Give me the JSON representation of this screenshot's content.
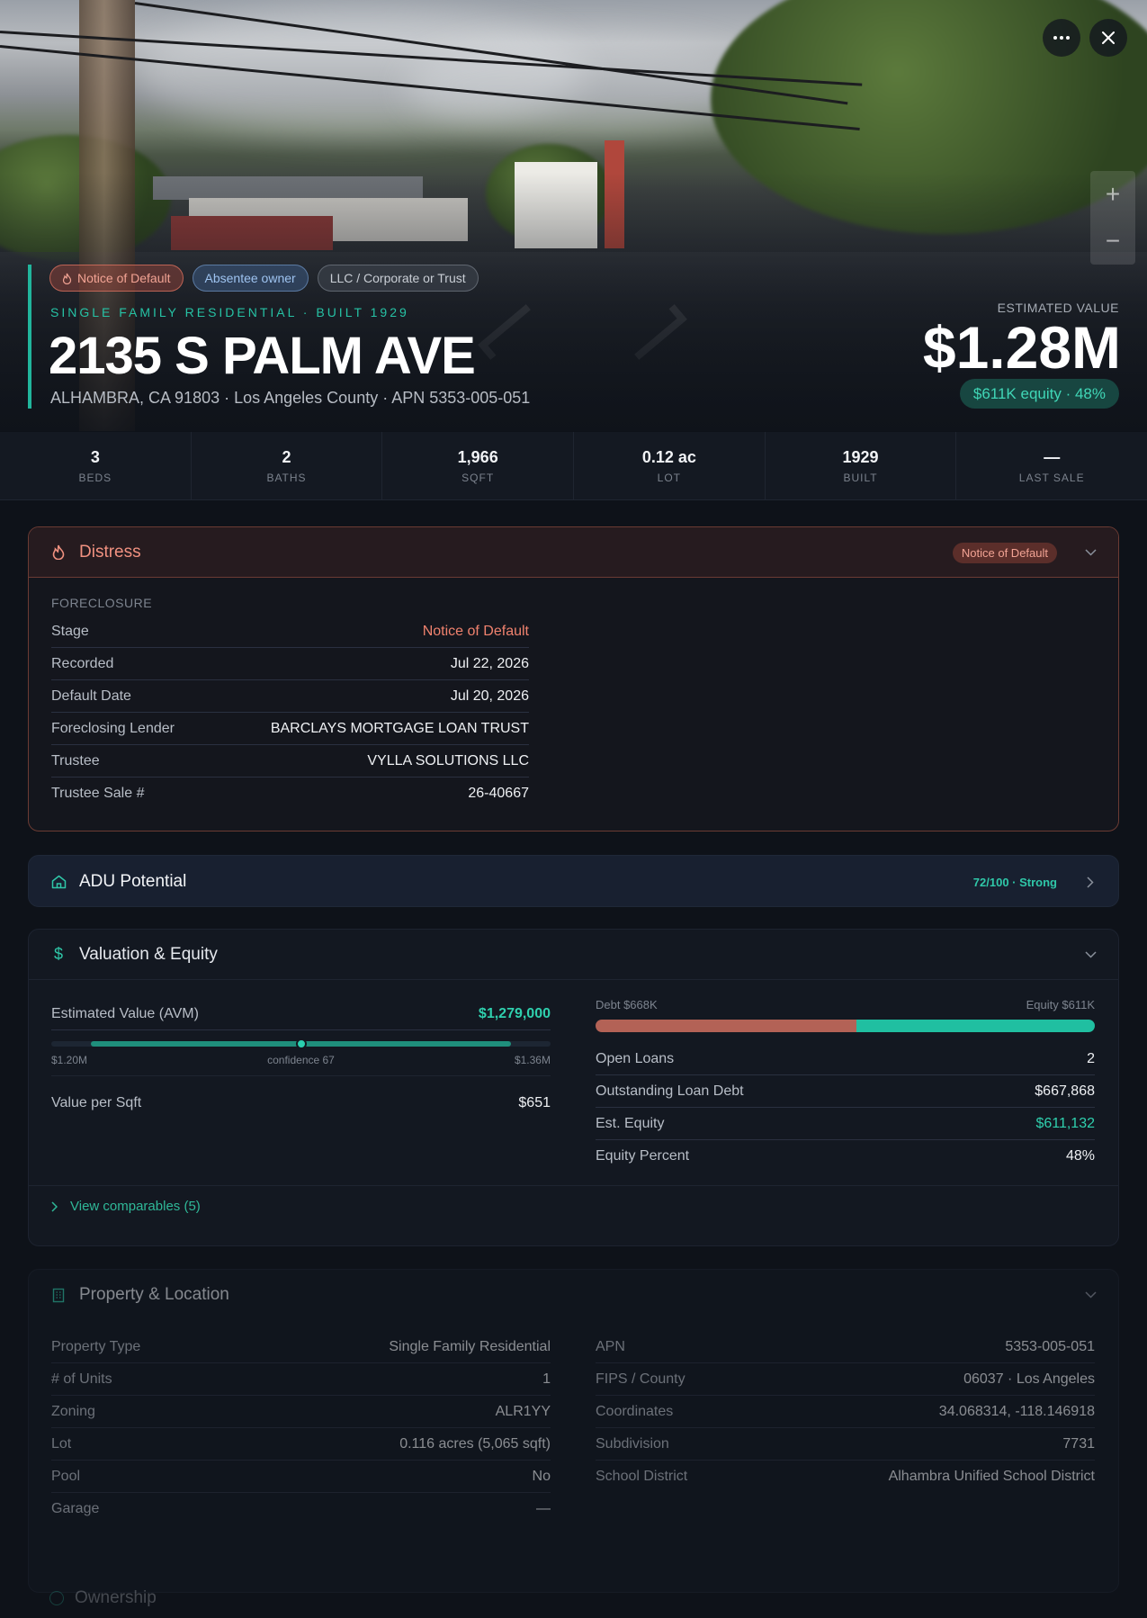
{
  "hero": {
    "tags": [
      {
        "label": "Notice of Default",
        "style": "red",
        "icon": "flame-icon"
      },
      {
        "label": "Absentee owner",
        "style": "blue"
      },
      {
        "label": "LLC / Corporate or Trust",
        "style": "gray"
      }
    ],
    "subtitle": "SINGLE FAMILY RESIDENTIAL · BUILT 1929",
    "title": "2135 S PALM AVE",
    "address": "ALHAMBRA, CA 91803 · Los Angeles County · APN 5353-005-051",
    "estimated_label": "ESTIMATED VALUE",
    "estimated_value": "$1.28M",
    "equity_pill": "$611K equity · 48%",
    "more_icon": "ellipsis-icon",
    "close_icon": "close-icon",
    "zoom_in": "+",
    "zoom_out": "−"
  },
  "stats": [
    {
      "value": "3",
      "label": "BEDS"
    },
    {
      "value": "2",
      "label": "BATHS"
    },
    {
      "value": "1,966",
      "label": "SQFT"
    },
    {
      "value": "0.12 ac",
      "label": "LOT"
    },
    {
      "value": "1929",
      "label": "BUILT"
    },
    {
      "value": "—",
      "label": "LAST SALE"
    }
  ],
  "distress": {
    "title": "Distress",
    "badge": "Notice of Default",
    "section": "FORECLOSURE",
    "rows": [
      {
        "k": "Stage",
        "v": "Notice of Default",
        "color": "#f0826e"
      },
      {
        "k": "Recorded",
        "v": "Jul 22, 2026"
      },
      {
        "k": "Default Date",
        "v": "Jul 20, 2026"
      },
      {
        "k": "Foreclosing Lender",
        "v": "BARCLAYS MORTGAGE LOAN TRUST"
      },
      {
        "k": "Trustee",
        "v": "VYLLA SOLUTIONS LLC"
      },
      {
        "k": "Trustee Sale #",
        "v": "26-40667"
      }
    ]
  },
  "adu": {
    "title": "ADU Potential",
    "score": "72/100 · Strong",
    "score_value": 72
  },
  "valuation": {
    "title": "Valuation & Equity",
    "avm_label": "Estimated Value (AVM)",
    "avm_value": "$1,279,000",
    "range_low": "$1.20M",
    "range_high": "$1.36M",
    "confidence": "confidence 67",
    "confidence_value": 67,
    "value_sqft_label": "Value per Sqft",
    "value_sqft": "$651",
    "debt_label": "Debt $668K",
    "equity_label": "Equity $611K",
    "debt_amount": 667868,
    "equity_amount": 611132,
    "rows": [
      {
        "k": "Open Loans",
        "v": "2"
      },
      {
        "k": "Outstanding Loan Debt",
        "v": "$667,868"
      },
      {
        "k": "Est. Equity",
        "v": "$611,132",
        "color": "#2fd0ae"
      },
      {
        "k": "Equity Percent",
        "v": "48%"
      }
    ],
    "comparables": "View comparables (5)"
  },
  "property": {
    "title": "Property & Location",
    "left": [
      {
        "k": "Property Type",
        "v": "Single Family Residential"
      },
      {
        "k": "# of Units",
        "v": "1"
      },
      {
        "k": "Zoning",
        "v": "ALR1YY"
      },
      {
        "k": "Lot",
        "v": "0.116 acres (5,065 sqft)"
      },
      {
        "k": "Pool",
        "v": "No"
      },
      {
        "k": "Garage",
        "v": "—"
      }
    ],
    "right": [
      {
        "k": "APN",
        "v": "5353-005-051"
      },
      {
        "k": "FIPS / County",
        "v": "06037 · Los Angeles"
      },
      {
        "k": "Coordinates",
        "v": "34.068314, -118.146918"
      },
      {
        "k": "Subdivision",
        "v": "7731"
      },
      {
        "k": "School District",
        "v": "Alhambra Unified School District"
      }
    ]
  },
  "ownership": {
    "title": "Ownership"
  },
  "colors": {
    "accent": "#21b59c",
    "distress": "#f09180",
    "debt": "#b36256",
    "equity": "#20bfa1"
  }
}
